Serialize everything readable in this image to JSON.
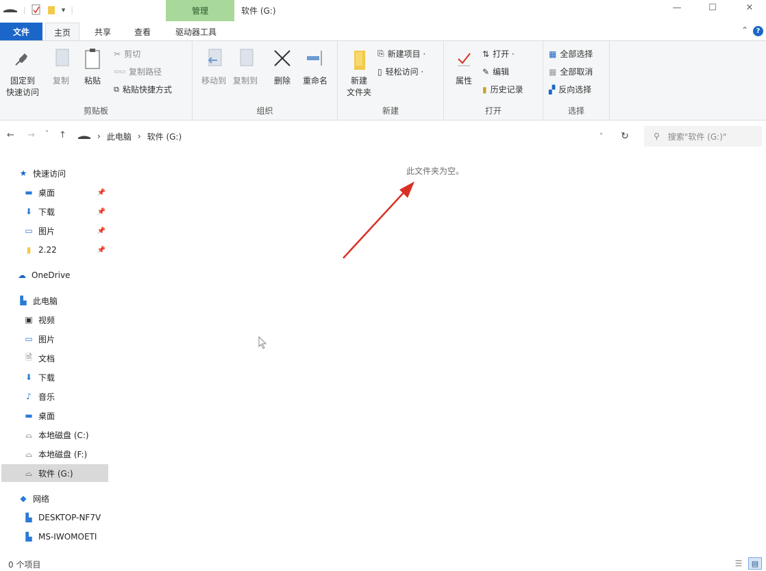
{
  "titlebar": {
    "manage_tab": "管理",
    "title": "软件 (G:)",
    "minimize": "—",
    "maximize": "☐",
    "close": "✕"
  },
  "tabs": {
    "file": "文件",
    "home": "主页",
    "share": "共享",
    "view": "查看",
    "drive_tools": "驱动器工具"
  },
  "ribbon": {
    "clipboard": {
      "label": "剪贴板",
      "pin": "固定到\n快速访问",
      "copy": "复制",
      "paste": "粘贴",
      "cut": "剪切",
      "copy_path": "复制路径",
      "paste_shortcut": "粘贴快捷方式"
    },
    "organize": {
      "label": "组织",
      "move_to": "移动到",
      "copy_to": "复制到",
      "delete": "删除",
      "rename": "重命名"
    },
    "new": {
      "label": "新建",
      "new_folder": "新建\n文件夹",
      "new_item": "新建项目 ·",
      "easy_access": "轻松访问 ·"
    },
    "open": {
      "label": "打开",
      "properties": "属性",
      "open": "打开 ·",
      "edit": "编辑",
      "history": "历史记录"
    },
    "select": {
      "label": "选择",
      "select_all": "全部选择",
      "select_none": "全部取消",
      "invert": "反向选择"
    }
  },
  "address": {
    "back": "←",
    "forward": "→",
    "recent": "˅",
    "up": "↑",
    "path": [
      "此电脑",
      "软件 (G:)"
    ],
    "dropdown": "˅",
    "refresh": "↻",
    "search_placeholder": "搜索\"软件 (G:)\""
  },
  "sidebar": {
    "quick_access": "快速访问",
    "quick_items": [
      {
        "label": "桌面",
        "icon": "desktop-icon"
      },
      {
        "label": "下载",
        "icon": "download-icon"
      },
      {
        "label": "图片",
        "icon": "pictures-icon"
      },
      {
        "label": "2.22",
        "icon": "folder-icon"
      }
    ],
    "onedrive": "OneDrive",
    "this_pc": "此电脑",
    "pc_items": [
      {
        "label": "视频",
        "icon": "video-icon"
      },
      {
        "label": "图片",
        "icon": "pictures-icon"
      },
      {
        "label": "文档",
        "icon": "documents-icon"
      },
      {
        "label": "下载",
        "icon": "download-icon"
      },
      {
        "label": "音乐",
        "icon": "music-icon"
      },
      {
        "label": "桌面",
        "icon": "desktop-icon"
      },
      {
        "label": "本地磁盘 (C:)",
        "icon": "drive-icon"
      },
      {
        "label": "本地磁盘 (F:)",
        "icon": "drive-icon"
      },
      {
        "label": "软件 (G:)",
        "icon": "drive-icon"
      }
    ],
    "network": "网络",
    "network_items": [
      {
        "label": "DESKTOP-NF7V",
        "icon": "computer-icon"
      },
      {
        "label": "MS-IWOMOETI",
        "icon": "computer-icon"
      }
    ]
  },
  "content": {
    "empty_message": "此文件夹为空。"
  },
  "status": {
    "item_count": "0 个项目"
  },
  "colors": {
    "accent": "#1b66c9",
    "manage_tab": "#a8d89a",
    "arrow": "#d93025"
  }
}
